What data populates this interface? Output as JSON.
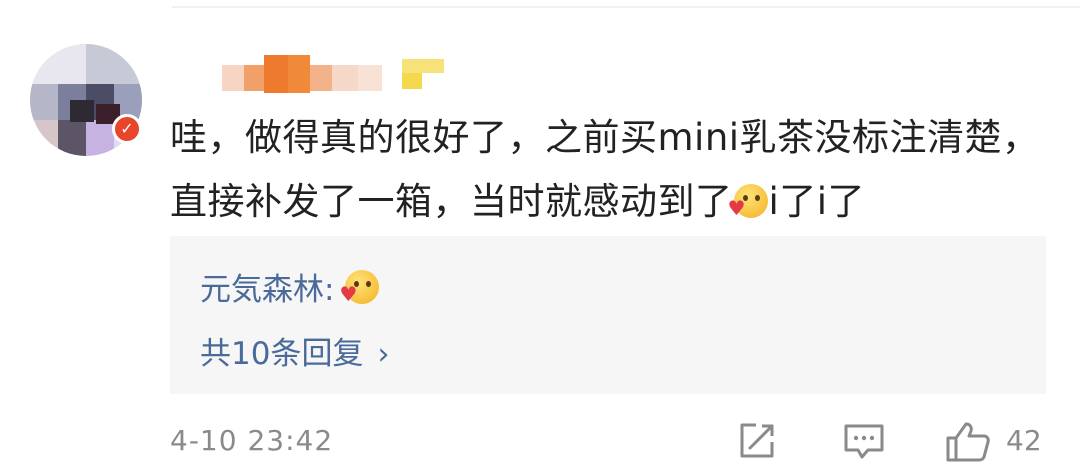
{
  "comment": {
    "text_part1": "哇，做得真的很好了，之前买mini乳茶没标注清楚，直接补发了一箱，当时就感动到了",
    "text_part2": "i了i了",
    "emoji": "smiling-face-with-heart-emoji"
  },
  "reply_preview": {
    "author": "元気森林:",
    "emoji": "smiling-face-with-heart-emoji",
    "more_label": "共10条回复",
    "more_icon": "chevron-right-icon"
  },
  "meta": {
    "timestamp": "4-10 23:42",
    "like_count": "42"
  },
  "icons": {
    "share": "share-edit-icon",
    "reply": "comment-icon",
    "like": "thumbs-up-icon"
  },
  "colors": {
    "link": "#4a6a9a",
    "muted": "#8a8a8a",
    "text": "#222222",
    "reply_bg": "#f6f6f6"
  }
}
